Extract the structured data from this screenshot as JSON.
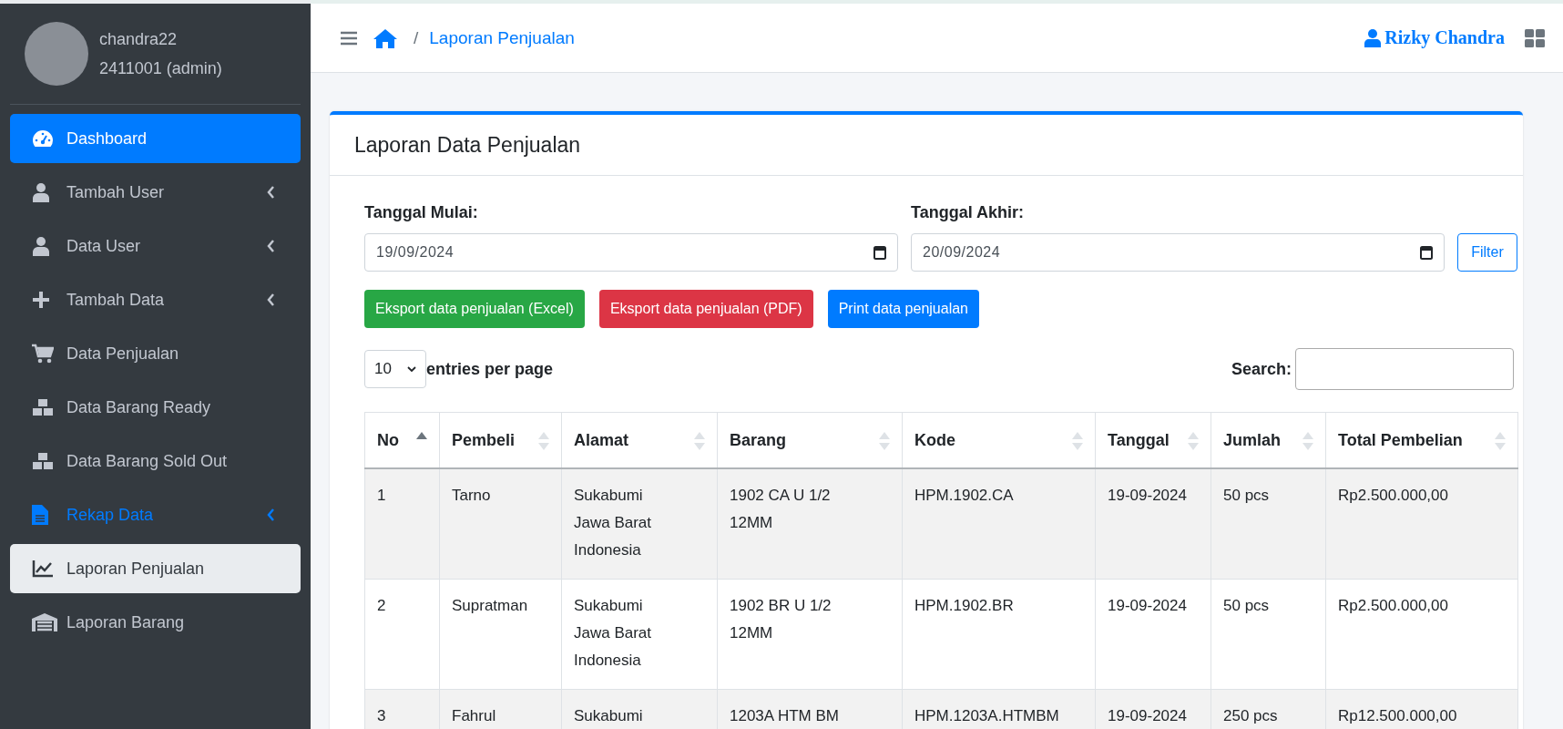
{
  "sidebar": {
    "user": {
      "name": "chandra22",
      "id_role": "2411001 (admin)"
    },
    "items": [
      {
        "label": "Dashboard",
        "active": true,
        "selected": false,
        "expanded": false,
        "has_submenu": false
      },
      {
        "label": "Tambah User",
        "active": false,
        "selected": false,
        "expanded": false,
        "has_submenu": true
      },
      {
        "label": "Data User",
        "active": false,
        "selected": false,
        "expanded": false,
        "has_submenu": true
      },
      {
        "label": "Tambah Data",
        "active": false,
        "selected": false,
        "expanded": false,
        "has_submenu": true
      },
      {
        "label": "Data Penjualan",
        "active": false,
        "selected": false,
        "expanded": false,
        "has_submenu": false
      },
      {
        "label": "Data Barang Ready",
        "active": false,
        "selected": false,
        "expanded": false,
        "has_submenu": false
      },
      {
        "label": "Data Barang Sold Out",
        "active": false,
        "selected": false,
        "expanded": false,
        "has_submenu": false
      },
      {
        "label": "Rekap Data",
        "active": false,
        "selected": false,
        "expanded": true,
        "has_submenu": true
      },
      {
        "label": "Laporan Penjualan",
        "active": false,
        "selected": true,
        "expanded": false,
        "has_submenu": false
      },
      {
        "label": "Laporan Barang",
        "active": false,
        "selected": false,
        "expanded": false,
        "has_submenu": false
      }
    ]
  },
  "header": {
    "breadcrumb": [
      "/",
      "Laporan Penjualan"
    ],
    "user_name": "Rizky Chandra"
  },
  "card": {
    "title": "Laporan Data Penjualan",
    "filters": [
      {
        "label": "Tanggal Mulai:",
        "value": "19/09/2024"
      },
      {
        "label": "Tanggal Akhir:",
        "value": "20/09/2024"
      }
    ],
    "filter_button": "Filter",
    "export_buttons": [
      {
        "label": "Eksport data penjualan (Excel)",
        "color": "#28a745"
      },
      {
        "label": "Eksport data penjualan (PDF)",
        "color": "#dc3545"
      },
      {
        "label": "Print data penjualan",
        "color": "#007bff"
      }
    ],
    "page_size": "10",
    "page_size_label": "entries per page",
    "search_label": "Search:",
    "table": {
      "columns": [
        {
          "label": "No",
          "sorted_ascending": true
        },
        {
          "label": "Pembeli",
          "sorted_ascending": false
        },
        {
          "label": "Alamat",
          "sorted_ascending": false
        },
        {
          "label": "Barang",
          "sorted_ascending": false
        },
        {
          "label": "Kode",
          "sorted_ascending": false
        },
        {
          "label": "Tanggal",
          "sorted_ascending": false
        },
        {
          "label": "Jumlah",
          "sorted_ascending": false
        },
        {
          "label": "Total Pembelian",
          "sorted_ascending": false
        }
      ],
      "rows": [
        [
          "1",
          "Tarno",
          "Sukabumi Jawa Barat Indonesia",
          "1902 CA U 1/2 12MM",
          "HPM.1902.CA",
          "19-09-2024",
          "50 pcs",
          "Rp2.500.000,00"
        ],
        [
          "2",
          "Supratman",
          "Sukabumi Jawa Barat Indonesia",
          "1902 BR U 1/2 12MM",
          "HPM.1902.BR",
          "19-09-2024",
          "50 pcs",
          "Rp2.500.000,00"
        ],
        [
          "3",
          "Fahrul",
          "Sukabumi",
          "1203A HTM BM",
          "HPM.1203A.HTMBM",
          "19-09-2024",
          "250 pcs",
          "Rp12.500.000,00"
        ]
      ]
    }
  }
}
